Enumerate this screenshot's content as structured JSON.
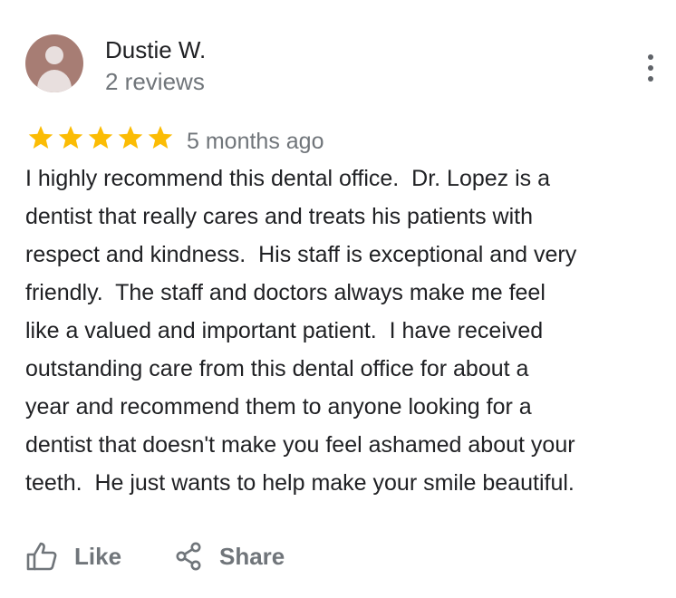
{
  "reviewer": {
    "name": "Dustie W.",
    "review_count": "2 reviews"
  },
  "review": {
    "rating": 5,
    "rating_max": 5,
    "date": "5 months ago",
    "lines": [
      "I highly recommend this dental office.  Dr. Lopez is a",
      "dentist that really cares and treats his patients with",
      "respect and kindness.  His staff is exceptional and very",
      "friendly.  The staff and doctors always make me feel",
      "like a valued and important patient.  I have received",
      "outstanding care from this dental office for about a",
      "year and recommend them to anyone looking for a",
      "dentist that doesn't make you feel ashamed about your",
      "teeth.  He just wants to help make your smile beautiful."
    ]
  },
  "actions": {
    "like_label": "Like",
    "share_label": "Share"
  },
  "icons": {
    "avatar": "person-avatar-icon",
    "menu": "more-vert-icon",
    "star": "star-icon",
    "like": "thumb-up-icon",
    "share": "share-icon"
  },
  "colors": {
    "star": "#FBBC04",
    "text": "#202124",
    "secondary": "#70757A",
    "avatar_bg": "#A77D74"
  }
}
